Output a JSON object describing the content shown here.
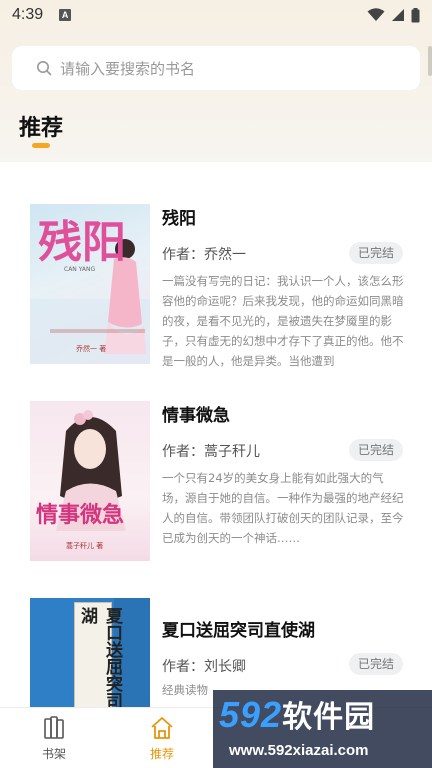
{
  "status_bar": {
    "time": "4:39",
    "notification_letter": "A"
  },
  "search": {
    "placeholder": "请输入要搜索的书名"
  },
  "section": {
    "title": "推荐"
  },
  "books": [
    {
      "title": "残阳",
      "author": "作者：乔然一",
      "status": "已完结",
      "description": "一篇没有写完的日记：我认识一个人，该怎么形容他的命运呢？后来我发现，他的命运如同黑暗的夜，是看不见光的，是被遗失在梦魇里的影子，只有虚无的幻想中才存下了真正的他。他不是一般的人，他是异类。当他遭到",
      "cover_title": "残阳",
      "cover_pinyin": "CAN YANG",
      "cover_author": "乔然一 著"
    },
    {
      "title": "情事微急",
      "author": "作者：蒿子秆儿",
      "status": "已完结",
      "description": "一个只有24岁的美女身上能有如此强大的气场，源自于她的自信。一种作为最强的地产经纪人的自信。带领团队打破创天的团队记录，至今已成为创天的一个神话……",
      "cover_title": "情事微急",
      "cover_author": "蒿子秆儿 著"
    },
    {
      "title": "夏口送屈突司直使湖",
      "author": "作者：刘长卿",
      "status": "已完结",
      "description": "经典读物",
      "cover_title": "夏口送屈突司直使湖"
    }
  ],
  "bottom_nav": [
    {
      "label": "书架",
      "icon": "bookshelf-icon",
      "active": false
    },
    {
      "label": "推荐",
      "icon": "home-icon",
      "active": true
    }
  ],
  "watermark": {
    "brand_digits": "592",
    "brand_cn": "软件园",
    "url": "www.592xiazai.com"
  },
  "colors": {
    "accent": "#f5a623",
    "nav_active": "#e8950c",
    "badge_bg": "#eef0f2"
  }
}
